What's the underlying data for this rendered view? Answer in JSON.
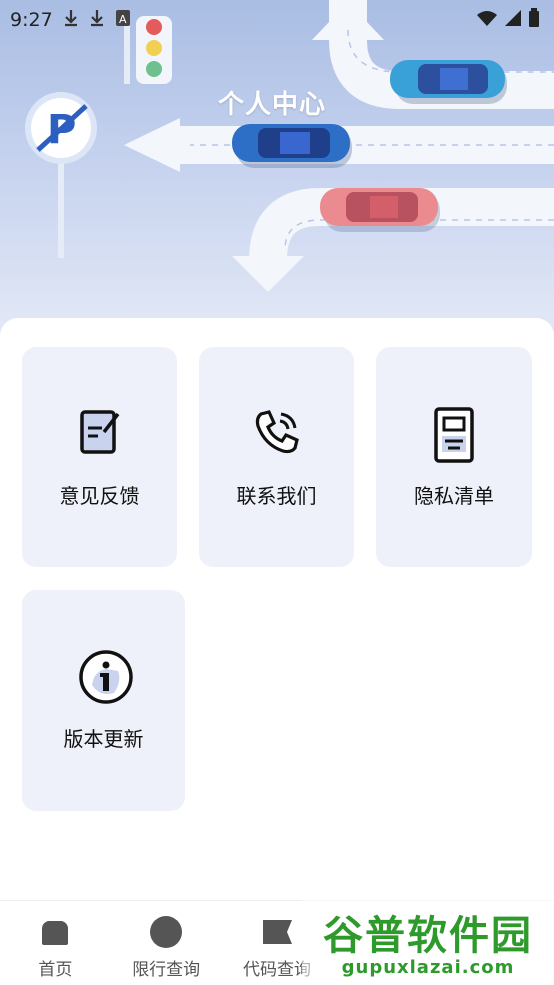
{
  "status": {
    "time": "9:27"
  },
  "hero": {
    "title": "个人中心"
  },
  "menu": [
    {
      "label": "意见反馈",
      "icon": "feedback-icon"
    },
    {
      "label": "联系我们",
      "icon": "phone-icon"
    },
    {
      "label": "隐私清单",
      "icon": "privacy-list-icon"
    },
    {
      "label": "版本更新",
      "icon": "info-icon"
    }
  ],
  "tabs": [
    {
      "label": "首页",
      "icon": "home-icon"
    },
    {
      "label": "限行查询",
      "icon": "circle-icon"
    },
    {
      "label": "代码查询",
      "icon": "flag-icon"
    }
  ],
  "watermark": {
    "title": "谷普软件园",
    "url": "gupuxlazai.com"
  },
  "colors": {
    "accent_blue": "#2d6fc7",
    "card_bg": "#eef1f9",
    "watermark_green": "#2f9a2c"
  }
}
